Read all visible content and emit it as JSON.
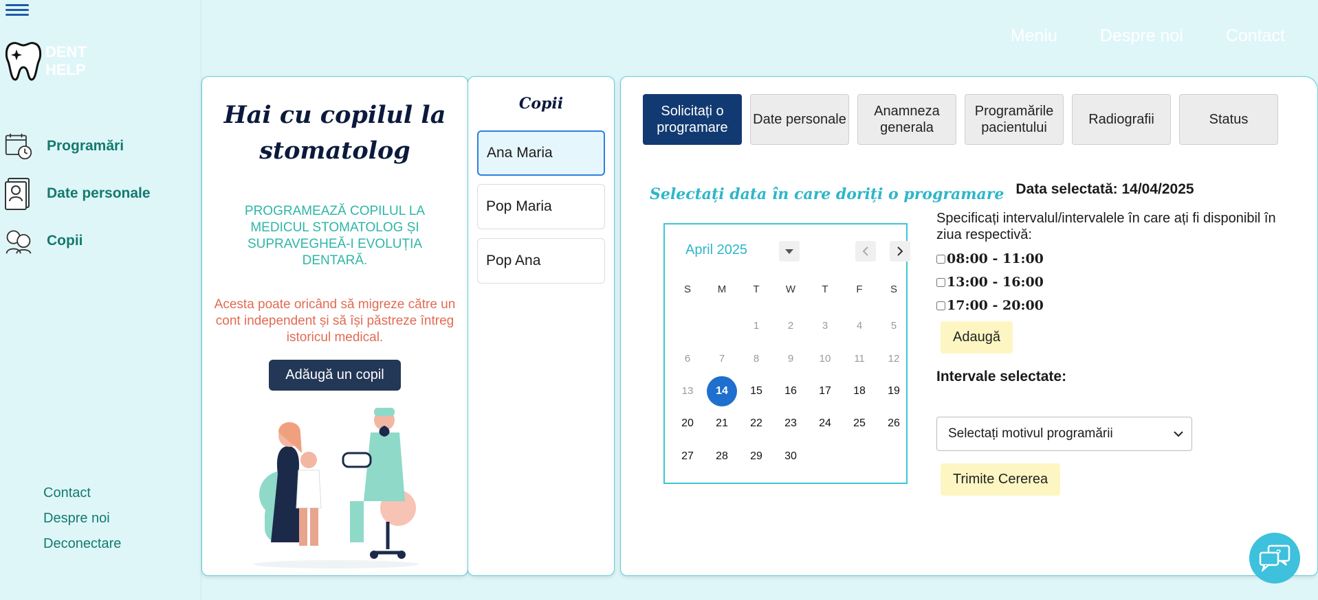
{
  "logo": {
    "line1": "DENT",
    "line2": "HELP"
  },
  "sidebar": {
    "items": [
      {
        "label": "Programări",
        "icon": "calendar-clock-icon"
      },
      {
        "label": "Date personale",
        "icon": "id-card-icon"
      },
      {
        "label": "Copii",
        "icon": "children-icon"
      }
    ],
    "bottom_links": [
      "Contact",
      "Despre noi",
      "Deconectare"
    ]
  },
  "topnav": [
    "Meniu",
    "Despre noi",
    "Contact"
  ],
  "hero": {
    "title": "Hai cu copilul la stomatolog",
    "subtitle": "PROGRAMEAZĂ COPILUL LA MEDICUL STOMATOLOG ȘI SUPRAVEGHEĂ-I EVOLUȚIA DENTARĂ.",
    "note": "Acesta poate oricând să migreze către un cont independent și să își păstreze întreg istoricul medical.",
    "add_button": "Adăugă un copil"
  },
  "children": {
    "title": "Copii",
    "list": [
      "Ana Maria",
      "Pop Maria",
      "Pop Ana"
    ],
    "selected": "Ana Maria"
  },
  "tabs": [
    {
      "label": "Solicitați o programare",
      "active": true
    },
    {
      "label": "Date personale"
    },
    {
      "label": "Anamneza generala"
    },
    {
      "label": "Programările pacientului"
    },
    {
      "label": "Radiografii"
    },
    {
      "label": "Status"
    }
  ],
  "calendar": {
    "heading": "Selectați data în care doriți o programare",
    "month": "April 2025",
    "weekdays": [
      "S",
      "M",
      "T",
      "W",
      "T",
      "F",
      "S"
    ],
    "first_weekday_index": 2,
    "days_in_month": 30,
    "selected_day": 14
  },
  "booking": {
    "selected_date_label": "Data selectată: 14/04/2025",
    "instructions": "Specificați intervalul/intervalele în care ați fi disponibil în ziua respectivă:",
    "slots": [
      "08:00 - 11:00",
      "13:00 - 16:00",
      "17:00 - 20:00"
    ],
    "add_button": "Adaugă",
    "intervals_title": "Intervale selectate:",
    "reason_select": "Selectați motivul programării",
    "submit_button": "Trimite Cererea"
  },
  "colors": {
    "accent": "#2eb6c8",
    "primary": "#123a72",
    "teal": "#137a6e",
    "orange": "#e26b52",
    "background": "#dff6f9"
  }
}
